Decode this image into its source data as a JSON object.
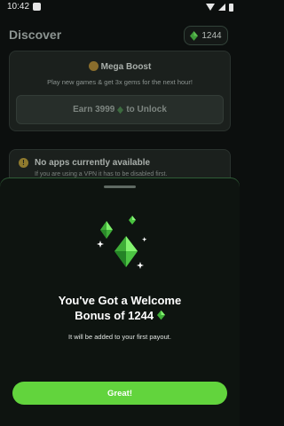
{
  "status_bar": {
    "time": "10:42"
  },
  "header": {
    "title": "Discover",
    "gem_count": "1244"
  },
  "boost": {
    "title": "Mega Boost",
    "subtitle": "Play new games & get 3x gems for the next hour!",
    "button_prefix": "Earn 3999",
    "button_suffix": "to Unlock"
  },
  "apps": {
    "title": "No apps currently available",
    "subtitle": "If you are using a VPN it has to be disabled first."
  },
  "sheet": {
    "title_line1": "You've Got a Welcome",
    "title_line2": "Bonus of 1244",
    "subtitle": "It will be added to your first payout.",
    "button": "Great!"
  },
  "colors": {
    "accent": "#62d43d",
    "gem": "#57e04a"
  }
}
